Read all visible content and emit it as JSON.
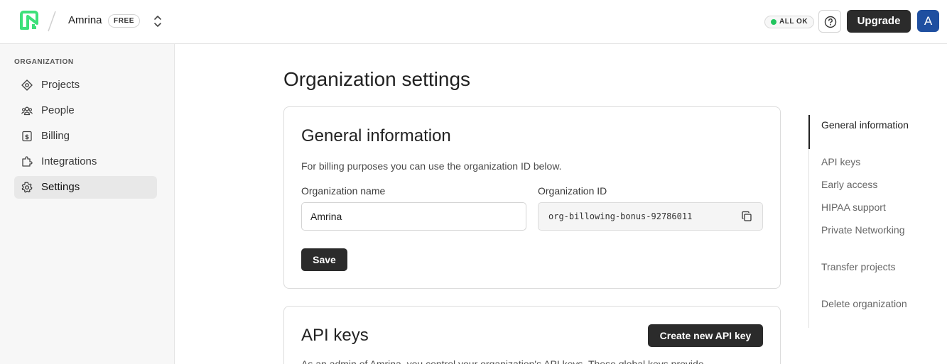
{
  "header": {
    "org_name": "Amrina",
    "plan_badge": "FREE",
    "status_label": "ALL OK",
    "status_color": "#22c55e",
    "upgrade_label": "Upgrade",
    "avatar_initial": "A",
    "avatar_color": "#1f4fa0",
    "logo_color": "#3ee07a"
  },
  "sidebar": {
    "section_label": "ORGANIZATION",
    "items": [
      {
        "label": "Projects",
        "icon": "projects-icon"
      },
      {
        "label": "People",
        "icon": "people-icon"
      },
      {
        "label": "Billing",
        "icon": "billing-icon"
      },
      {
        "label": "Integrations",
        "icon": "integrations-icon"
      },
      {
        "label": "Settings",
        "icon": "settings-icon",
        "active": true
      }
    ]
  },
  "main": {
    "page_title": "Organization settings",
    "general": {
      "title": "General information",
      "description": "For billing purposes you can use the organization ID below.",
      "org_name_label": "Organization name",
      "org_name_value": "Amrina",
      "org_id_label": "Organization ID",
      "org_id_value": "org-billowing-bonus-92786011",
      "save_label": "Save"
    },
    "api_keys": {
      "title": "API keys",
      "create_label": "Create new API key",
      "description": "As an admin of Amrina, you control your organization's API keys. These global keys provide"
    }
  },
  "toc": {
    "items": [
      {
        "label": "General information",
        "active": true
      },
      {
        "label": "API keys"
      },
      {
        "label": "Early access"
      },
      {
        "label": "HIPAA support"
      },
      {
        "label": "Private Networking"
      },
      {
        "label": "Transfer projects"
      },
      {
        "label": "Delete organization"
      }
    ]
  }
}
